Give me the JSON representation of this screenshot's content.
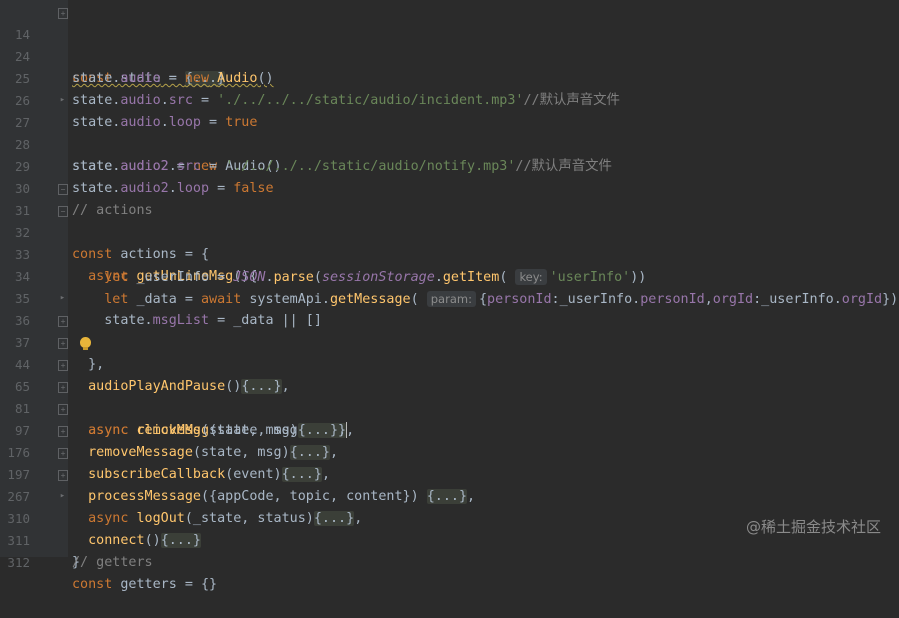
{
  "editor": {
    "lines": {
      "l14": "14",
      "l24": "24",
      "l25": "25",
      "l26": "26",
      "l27": "27",
      "l28": "28",
      "l29": "29",
      "l30": "30",
      "l31": "31",
      "l32": "32",
      "l33": "33",
      "l34": "34",
      "l35": "35",
      "l36": "36",
      "l37": "37",
      "l44": "44",
      "l65": "65",
      "l81": "81",
      "l97": "97",
      "l176": "176",
      "l197": "197",
      "l267": "267",
      "l310": "310",
      "l311": "311",
      "l312": "312"
    },
    "folded": "{...}",
    "fold_comma": "{...},",
    "hints": {
      "key": "key:",
      "param": "param:"
    },
    "strings": {
      "incident": "'./../../../static/audio/incident.mp3'",
      "notify": "'./../../../static/audio/notify.mp3'",
      "userInfo": "'userInfo'"
    },
    "comments": {
      "default_sound": "//默认声音文件",
      "actions": "// actions",
      "getters": "// getters"
    }
  },
  "watermark": "@稀土掘金技术社区",
  "colors": {
    "background": "#2b2b2b",
    "gutter": "#313335",
    "keyword": "#cc7832",
    "function": "#ffc66d",
    "string": "#6a8759",
    "property": "#9876aa",
    "comment": "#808080"
  }
}
